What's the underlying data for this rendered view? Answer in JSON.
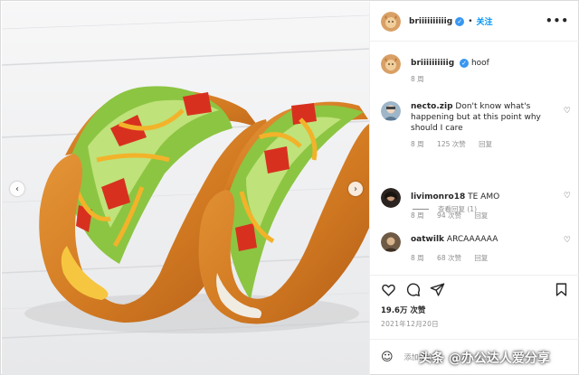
{
  "post": {
    "author": "briiiiiiiiiig",
    "caption": "hoof",
    "caption_age": "8 周",
    "follow_label": "关注",
    "dot": "•",
    "more": "•••",
    "verified_glyph": "✓"
  },
  "comments": [
    {
      "user": "necto.zip",
      "text": "Don't know what's happening but at this point why should I care",
      "age": "8 周",
      "likes": "125 次赞",
      "reply": "回复",
      "view_replies": "查看回复 (1)"
    },
    {
      "user": "livimonro18",
      "text": "TE AMO",
      "age": "8 周",
      "likes": "94 次赞",
      "reply": "回复"
    },
    {
      "user": "oatwilk",
      "text": "ARCAAAAAA",
      "age": "8 周",
      "likes": "68 次赞",
      "reply": "回复"
    }
  ],
  "icons": {
    "like": "heart-icon",
    "comment": "comment-icon",
    "share": "share-icon",
    "save": "bookmark-icon",
    "emoji": "smiley-icon",
    "prev": "chevron-left-icon",
    "next": "chevron-right-icon"
  },
  "glyphs": {
    "heart": "♡",
    "prev": "‹",
    "next": "›",
    "emoji": "☺"
  },
  "stats": {
    "likes": "19.6万 次赞",
    "date": "2021年12月20日"
  },
  "composer": {
    "placeholder": "添加评论..."
  },
  "watermark": "头条 @办公达人爱分享",
  "colors": {
    "accent": "#0095f6",
    "verified": "#3897f0",
    "muted": "#8e8e8e",
    "text": "#262626"
  }
}
